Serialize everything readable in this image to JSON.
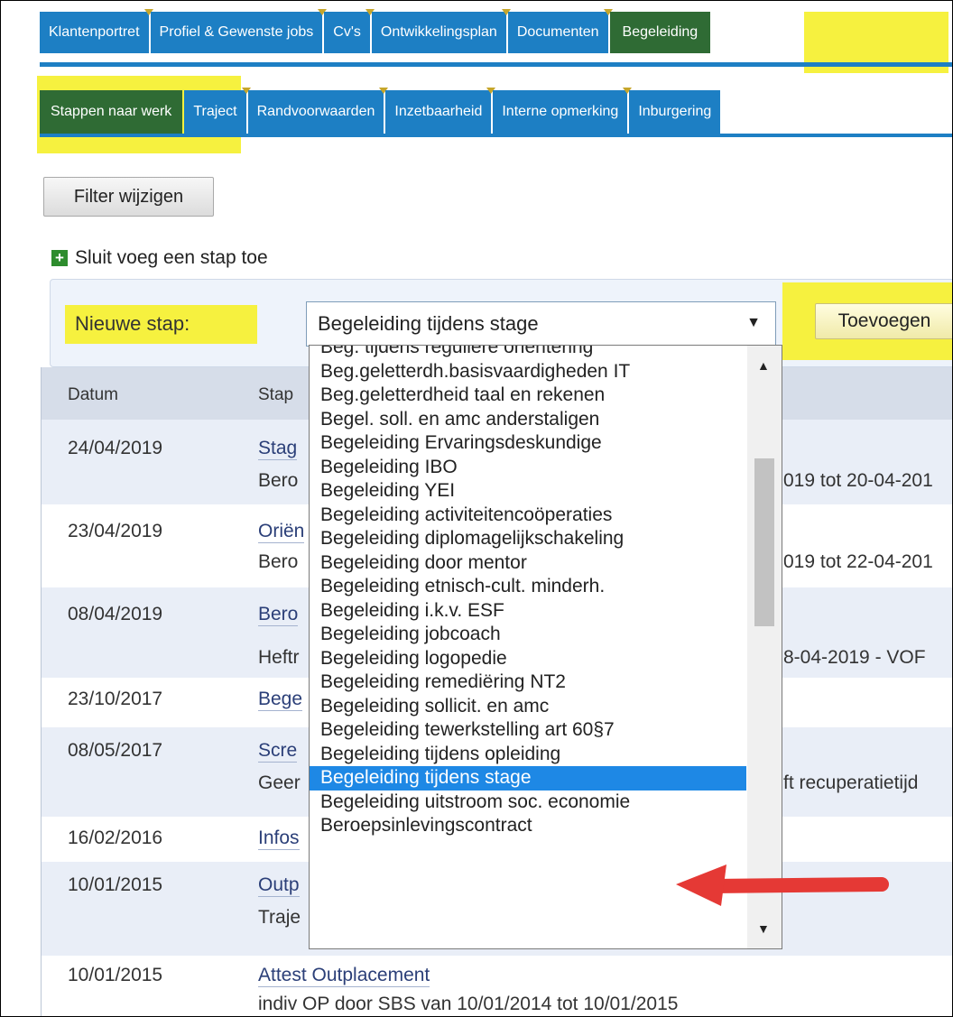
{
  "tabs": [
    "Klantenportret",
    "Profiel & Gewenste jobs",
    "Cv's",
    "Ontwikkelingsplan",
    "Documenten",
    "Begeleiding"
  ],
  "subtabs": [
    "Stappen naar werk",
    "Traject",
    "Randvoorwaarden",
    "Inzetbaarheid",
    "Interne opmerking",
    "Inburgering"
  ],
  "toolbar": {
    "filter_label": "Filter wijzigen",
    "add_link": "Sluit voeg een stap toe"
  },
  "form": {
    "label": "Nieuwe stap:",
    "selected": "Begeleiding tijdens stage",
    "add_button": "Toevoegen"
  },
  "table": {
    "headers": [
      "Datum",
      "Stap"
    ],
    "rows": [
      {
        "date": "24/04/2019",
        "step": "Stag",
        "sub": "Bero",
        "right": "019 tot 20-04-201"
      },
      {
        "date": "23/04/2019",
        "step": "Oriën",
        "sub": "Bero",
        "right": "019 tot 22-04-201"
      },
      {
        "date": "08/04/2019",
        "step": "Bero",
        "sub": "Heftr",
        "right": "8-04-2019 - VOF"
      },
      {
        "date": "23/10/2017",
        "step": "Bege",
        "sub": "",
        "right": ""
      },
      {
        "date": "08/05/2017",
        "step": "Scre",
        "sub": "Geer",
        "right": "ft recuperatietijd"
      },
      {
        "date": "16/02/2016",
        "step": "Infos",
        "sub": "",
        "right": ""
      },
      {
        "date": "10/01/2015",
        "step": "Outp",
        "sub": "Traje",
        "right": ""
      },
      {
        "date": "10/01/2015",
        "step": "Attest Outplacement",
        "sub": "indiv OP door SBS van 10/01/2014 tot 10/01/2015",
        "right": ""
      }
    ]
  },
  "dropdown_options": [
    "Beg. tijdens reguliere oriëntering",
    "Beg.geletterdh.basisvaardigheden IT",
    "Beg.geletterdheid taal en rekenen",
    "Begel. soll. en amc anderstaligen",
    "Begeleiding Ervaringsdeskundige",
    "Begeleiding IBO",
    "Begeleiding YEI",
    "Begeleiding activiteitencoöperaties",
    "Begeleiding diplomagelijkschakeling",
    "Begeleiding door mentor",
    "Begeleiding etnisch-cult. minderh.",
    "Begeleiding i.k.v. ESF",
    "Begeleiding jobcoach",
    "Begeleiding logopedie",
    "Begeleiding remediëring NT2",
    "Begeleiding sollicit. en amc",
    "Begeleiding tewerkstelling art 60§7",
    "Begeleiding tijdens opleiding",
    "Begeleiding tijdens stage",
    "Begeleiding uitstroom soc. economie",
    "Beroepsinlevingscontract"
  ],
  "colors": {
    "tab_blue": "#1d7fc4",
    "tab_active": "#2f6b34",
    "highlight": "#f6f13f",
    "selection": "#1e88e5",
    "arrow": "#e53935"
  }
}
